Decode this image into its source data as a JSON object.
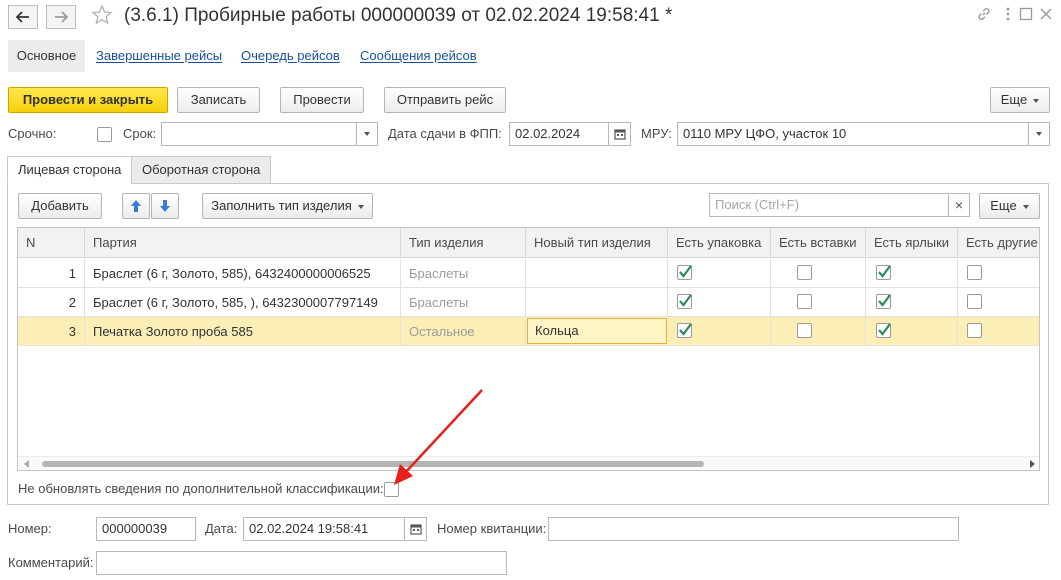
{
  "window": {
    "title": "(3.6.1) Пробирные работы 000000039 от 02.02.2024 19:58:41 *"
  },
  "sections": {
    "main": "Основное",
    "completed": "Завершенные рейсы",
    "queue": "Очередь рейсов",
    "messages": "Сообщения рейсов"
  },
  "toolbar": {
    "post_close": "Провести и закрыть",
    "save": "Записать",
    "post": "Провести",
    "send": "Отправить рейс",
    "more": "Еще"
  },
  "form": {
    "urgent_label": "Срочно:",
    "deadline_label": "Срок:",
    "deadline_value": "",
    "fpp_label": "Дата сдачи в ФПП:",
    "fpp_value": "02.02.2024",
    "mru_label": "МРУ:",
    "mru_value": "0110 МРУ ЦФО, участок 10"
  },
  "tabs": {
    "front": "Лицевая сторона",
    "back": "Оборотная сторона"
  },
  "table_toolbar": {
    "add": "Добавить",
    "fill": "Заполнить тип изделия",
    "search_placeholder": "Поиск (Ctrl+F)",
    "clear": "×",
    "more": "Еще"
  },
  "table": {
    "columns": [
      "N",
      "Партия",
      "Тип изделия",
      "Новый тип изделия",
      "Есть упаковка",
      "Есть вставки",
      "Есть ярлыки",
      "Есть другие"
    ],
    "rows": [
      {
        "n": "1",
        "batch": "Браслет (6 г, Золото, 585), 6432400000006525",
        "type": "Браслеты",
        "new_type": "",
        "packaging": true,
        "inserts": false,
        "labels": true,
        "other": false
      },
      {
        "n": "2",
        "batch": "Браслет (6 г, Золото, 585, ), 6432300007797149",
        "type": "Браслеты",
        "new_type": "",
        "packaging": true,
        "inserts": false,
        "labels": true,
        "other": false
      },
      {
        "n": "3",
        "batch": "Печатка Золото проба 585",
        "type": "Остальное",
        "new_type": "Кольца",
        "packaging": true,
        "inserts": false,
        "labels": true,
        "other": false
      }
    ]
  },
  "no_update_label": "Не обновлять сведения по дополнительной классификации:",
  "footer": {
    "number_label": "Номер:",
    "number_value": "000000039",
    "date_label": "Дата:",
    "date_value": "02.02.2024 19:58:41",
    "receipt_label": "Номер квитанции:",
    "receipt_value": "",
    "comment_label": "Комментарий:",
    "comment_value": ""
  },
  "colors": {
    "primary_button": "#f5cf0a",
    "link": "#1a4f9c",
    "check": "#2e8b57",
    "selected_row": "#fbeeb6",
    "annotation_arrow": "#e8201c"
  },
  "icons": [
    "back-arrow-icon",
    "forward-arrow-icon",
    "favorite-star-icon",
    "link-icon",
    "more-vertical-icon",
    "maximize-icon",
    "close-icon",
    "calendar-icon",
    "move-up-icon",
    "move-down-icon",
    "annotation-arrow"
  ]
}
